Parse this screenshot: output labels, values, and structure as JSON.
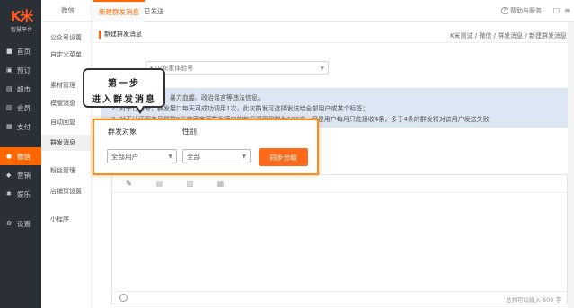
{
  "logo": {
    "mark": "K米",
    "sub": "智慧平台"
  },
  "leftnav": [
    {
      "label": "首页",
      "icon": "home-icon",
      "glyph": "■"
    },
    {
      "label": "预订",
      "icon": "booking-icon",
      "glyph": "▣"
    },
    {
      "label": "超市",
      "icon": "market-icon",
      "glyph": "▤"
    },
    {
      "label": "会员",
      "icon": "member-icon",
      "glyph": "▥"
    },
    {
      "label": "支付",
      "icon": "pay-icon",
      "glyph": "▦"
    },
    {
      "label": "微信",
      "icon": "wechat-icon",
      "glyph": "●"
    },
    {
      "label": "营销",
      "icon": "marketing-icon",
      "glyph": "◆"
    },
    {
      "label": "娱乐",
      "icon": "entertainment-icon",
      "glyph": "✱"
    },
    {
      "label": "设置",
      "icon": "settings-icon",
      "glyph": "⚙"
    }
  ],
  "subnav": {
    "head": "微信",
    "items": [
      "公众号设置",
      "自定义菜单",
      "素材管理",
      "模版消息",
      "自动回复",
      "群发消息",
      "粉丝管理",
      "店铺页设置",
      "小程序"
    ]
  },
  "tabs": [
    "新建群发消息",
    "已发送"
  ],
  "help": "帮助与服务",
  "breadcrumb": {
    "title": "新建群发消息",
    "path": "K米测试 / 微信 / 群发消息 / 新建群发消息"
  },
  "form": {
    "account_value": "KTV商家体验号",
    "info_lines": [
      "1.  ……色情、低俗、暴力血腥、政治谣言等违法信息。",
      "2.  对于订阅号，群发接口每天可成功调用1次，此次群发可选择发送给全部用户或某个标签；",
      "3.  对于认证服务号是群K米使用商家群发接口的每日调用限制为100次，但是用户每月只能接收4条，多于4条的群发将对该用户发送失败"
    ]
  },
  "popup": {
    "target_label": "群发对象",
    "gender_label": "性别",
    "target_value": "全部用户",
    "gender_value": "全部",
    "sync_button": "同步分组"
  },
  "callout": {
    "line1": "第一步",
    "line2": "进入群发消息"
  },
  "editor": {
    "counter": "总共可以输入 600 字"
  }
}
